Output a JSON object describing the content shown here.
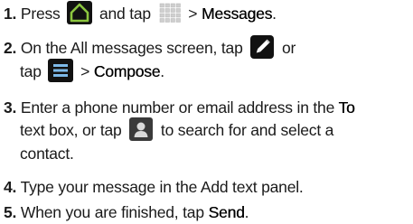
{
  "steps": [
    {
      "num": "1.",
      "parts": {
        "a": "Press",
        "b": "and tap",
        "c": "> ",
        "d": "Messages",
        "e": "."
      },
      "icons": [
        "home-icon",
        "apps-grid-icon"
      ]
    },
    {
      "num": "2.",
      "line1": {
        "a": "On the All messages screen, tap",
        "b": "or"
      },
      "line2": {
        "a": "tap",
        "b": "> ",
        "c": "Compose",
        "d": "."
      },
      "icons": [
        "pencil-compose-icon",
        "menu-icon"
      ]
    },
    {
      "num": "3.",
      "line1": {
        "a": "Enter a phone number or email address in the",
        "b": "To"
      },
      "line2": {
        "a": "text box, or tap",
        "b": "to search for and select a"
      },
      "line3": {
        "a": "contact."
      },
      "icons": [
        "contact-person-icon"
      ]
    },
    {
      "num": "4.",
      "text": "Type your message in the Add text panel."
    },
    {
      "num": "5.",
      "a": "When you are finished, tap",
      "b": "Send",
      "c": "."
    }
  ],
  "colors": {
    "accent": "#7db9e8",
    "icon_dark": "#111111",
    "text": "#1a1a1a"
  }
}
